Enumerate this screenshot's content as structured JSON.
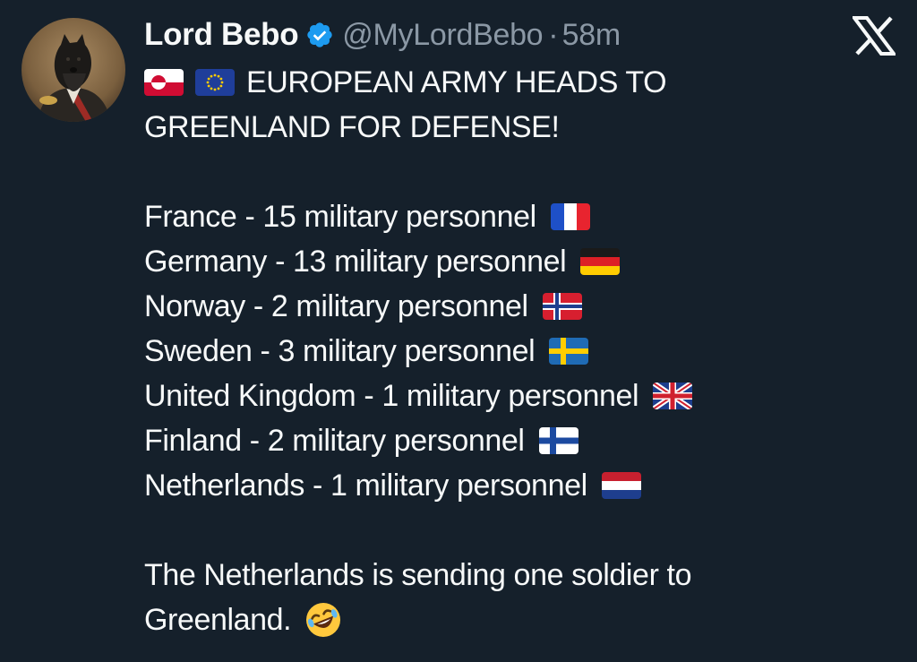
{
  "post": {
    "author": {
      "display_name": "Lord Bebo",
      "handle": "@MyLordBebo",
      "separator": "·",
      "timestamp": "58m",
      "avatar_icon": "dog-in-suit-portrait-avatar",
      "verified_icon": "verified-badge-icon"
    },
    "platform_icon": "x-logo-icon",
    "headline_flags": [
      "greenland-flag-icon",
      "eu-flag-icon"
    ],
    "headline_line1": "EUROPEAN ARMY HEADS TO",
    "headline_line2": "GREENLAND FOR DEFENSE!",
    "countries": [
      {
        "text": "France - 15 military personnel",
        "flag": "france-flag-icon"
      },
      {
        "text": "Germany - 13 military personnel",
        "flag": "germany-flag-icon"
      },
      {
        "text": "Norway - 2 military personnel",
        "flag": "norway-flag-icon"
      },
      {
        "text": "Sweden - 3 military personnel",
        "flag": "sweden-flag-icon"
      },
      {
        "text": "United Kingdom - 1 military personnel",
        "flag": "uk-flag-icon"
      },
      {
        "text": "Finland - 2 military personnel",
        "flag": "finland-flag-icon"
      },
      {
        "text": "Netherlands - 1 military personnel",
        "flag": "netherlands-flag-icon"
      }
    ],
    "closing_line1": "The Netherlands is sending one soldier to",
    "closing_line2": "Greenland.",
    "closing_emoji": "rolling-on-floor-laughing-emoji"
  },
  "theme": {
    "background": "#15202b",
    "text_primary": "#f7f9f9",
    "text_secondary": "#8b98a5",
    "verified_blue": "#1d9bf0"
  }
}
